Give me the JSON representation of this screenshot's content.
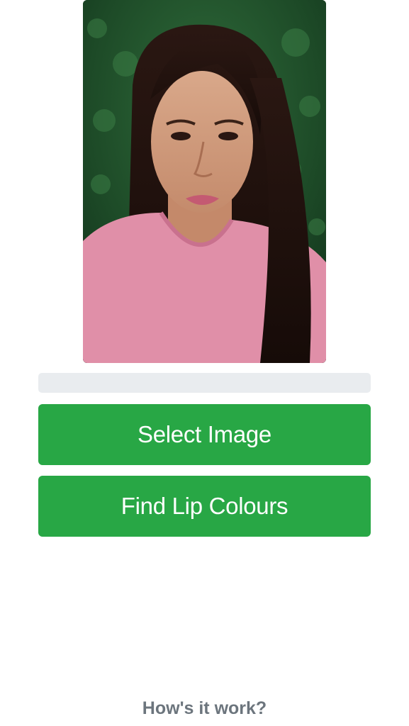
{
  "photo": {
    "alt": "portrait photo"
  },
  "progress": {
    "value_percent": 0
  },
  "buttons": {
    "select_image": "Select Image",
    "find_lip_colours": "Find Lip Colours"
  },
  "footer": {
    "how_it_works": "How's it work?"
  },
  "colors": {
    "button": "#28a745",
    "progress_track": "#e9ecef",
    "link": "#6c757d"
  }
}
